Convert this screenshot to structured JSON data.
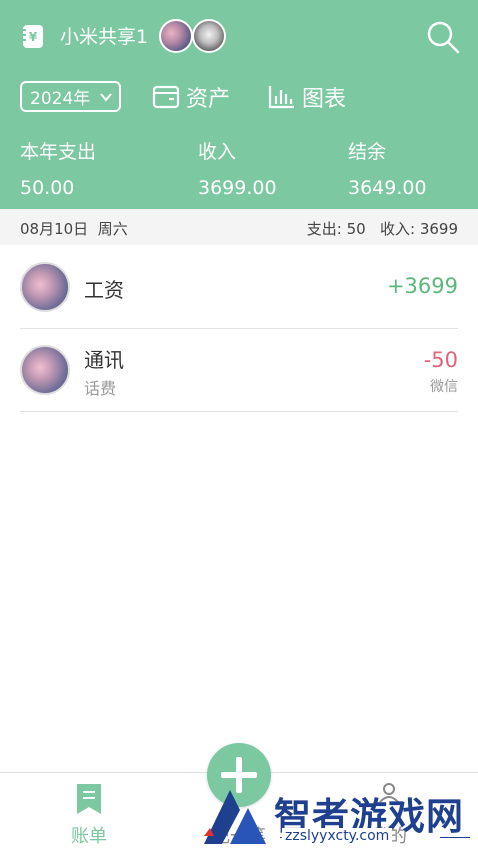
{
  "header": {
    "book_name": "小米共享1",
    "year": "2024年",
    "assets_label": "资产",
    "charts_label": "图表",
    "background_color": "#7cc8a0"
  },
  "summary": {
    "expense_label": "本年支出",
    "expense_value": "50.00",
    "income_label": "收入",
    "income_value": "3699.00",
    "balance_label": "结余",
    "balance_value": "3649.00"
  },
  "day_group": {
    "date": "08月10日",
    "weekday": "周六",
    "expense_label": "支出:",
    "expense_value": "50",
    "income_label": "收入:",
    "income_value": "3699"
  },
  "transactions": [
    {
      "category": "工资",
      "note": "",
      "amount": "+3699",
      "account": "",
      "type": "income",
      "color": "#5cb87a"
    },
    {
      "category": "通讯",
      "note": "话费",
      "amount": "-50",
      "account": "微信",
      "type": "expense",
      "color": "#e0637a"
    }
  ],
  "tabbar": {
    "ledger_label": "账单",
    "record_label": "记一笔",
    "mine_label": "我的",
    "active_color": "#7cc8a0"
  },
  "watermark": {
    "title": "智者游戏网",
    "url": "zzslyyxcty.com"
  }
}
